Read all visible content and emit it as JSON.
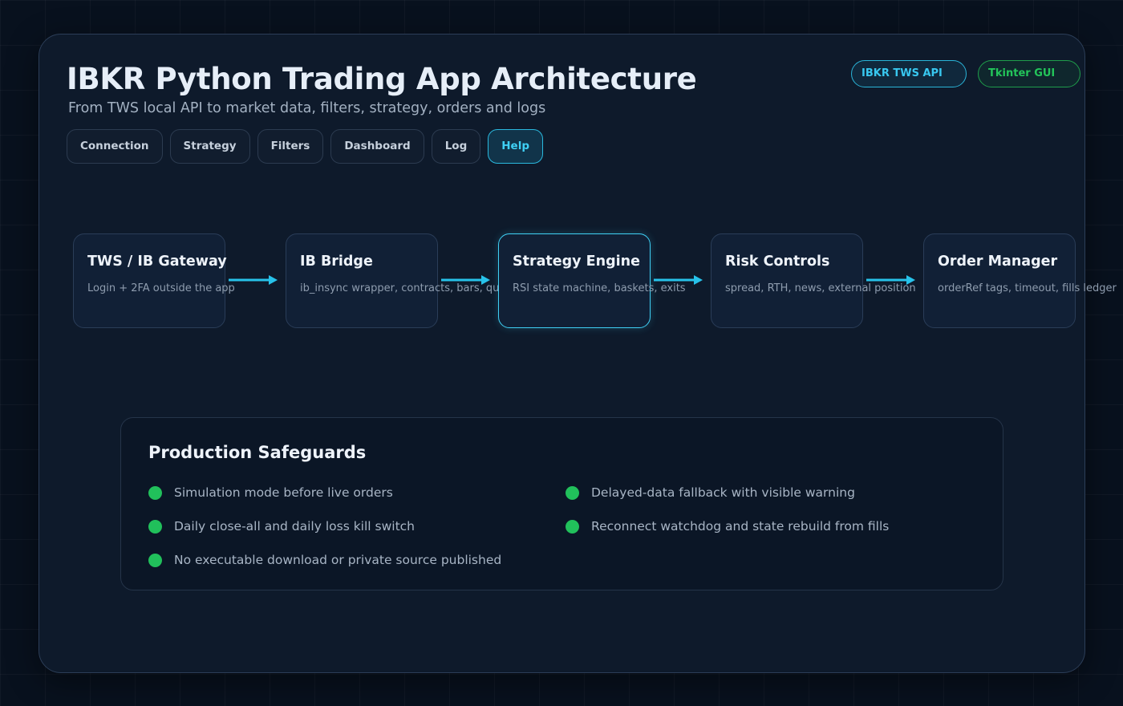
{
  "header": {
    "title": "IBKR Python Trading App Architecture",
    "subtitle": "From TWS local API to market data, filters, strategy, orders and logs"
  },
  "badges": [
    {
      "label": "IBKR TWS API",
      "color": "#38c7ef"
    },
    {
      "label": "Tkinter GUI",
      "color": "#23c55a"
    }
  ],
  "tabs": [
    {
      "label": "Connection",
      "active": false
    },
    {
      "label": "Strategy",
      "active": false
    },
    {
      "label": "Filters",
      "active": false
    },
    {
      "label": "Dashboard",
      "active": false
    },
    {
      "label": "Log",
      "active": false
    },
    {
      "label": "Help",
      "active": true
    }
  ],
  "pipeline": [
    {
      "title": "TWS / IB Gateway",
      "desc": "Login + 2FA outside the app",
      "highlight": false
    },
    {
      "title": "IB Bridge",
      "desc": "ib_insync wrapper, contracts, bars, quotes",
      "highlight": false
    },
    {
      "title": "Strategy Engine",
      "desc": "RSI state machine, baskets, exits",
      "highlight": true
    },
    {
      "title": "Risk Controls",
      "desc": "spread, RTH, news, external position",
      "highlight": false
    },
    {
      "title": "Order Manager",
      "desc": "orderRef tags, timeout, fills ledger",
      "highlight": false
    }
  ],
  "safeguards": {
    "title": "Production Safeguards",
    "items": [
      "Simulation mode before live orders",
      "Delayed-data fallback with visible warning",
      "Daily close-all and daily loss kill switch",
      "Reconnect watchdog and state rebuild from fills",
      "No executable download or private source published"
    ]
  },
  "colors": {
    "accent": "#3fd0f5",
    "success": "#21c05b",
    "background": "#08111e",
    "panel": "#0e1a2b"
  }
}
